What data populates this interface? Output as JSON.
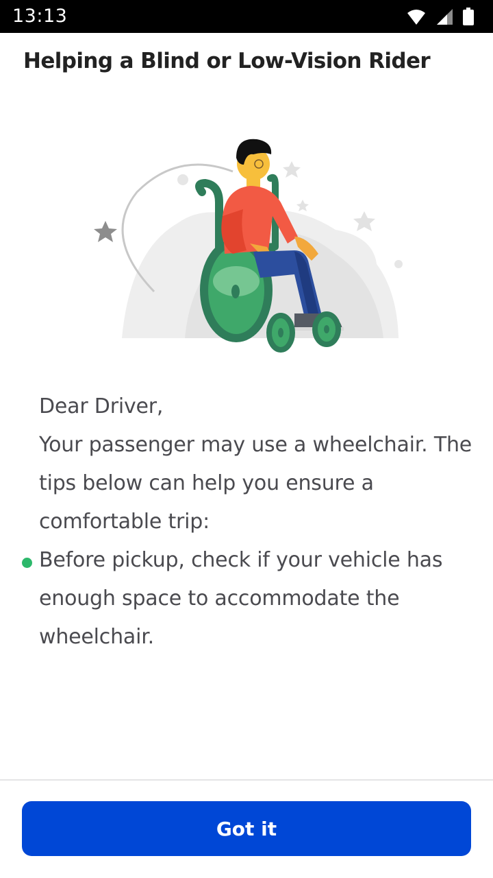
{
  "status_bar": {
    "time": "13:13"
  },
  "header": {
    "title": "Helping a Blind or Low-Vision Rider"
  },
  "illustration": {
    "name": "wheelchair-user-illustration"
  },
  "message": {
    "greeting": "Dear Driver,",
    "intro": "Your passenger may use a wheelchair. The tips below can help you ensure a comfortable trip:",
    "tips": [
      "Before pickup, check if your vehicle has enough space to accommodate the wheelchair."
    ]
  },
  "footer": {
    "button_label": "Got it"
  },
  "colors": {
    "accent": "#0047d6",
    "bullet": "#2db86b",
    "wheel": "#2f7d5a",
    "shirt": "#f25a44"
  }
}
